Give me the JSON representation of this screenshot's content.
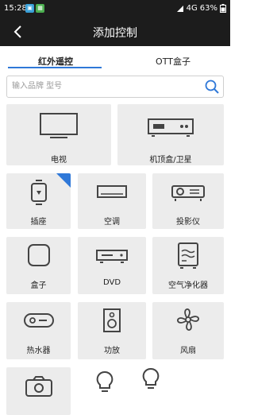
{
  "status_bar": {
    "time": "15:28",
    "network": "4G",
    "battery": "63%"
  },
  "header": {
    "title": "添加控制"
  },
  "tabs": [
    {
      "label": "红外遥控",
      "active": true
    },
    {
      "label": "OTT盒子",
      "active": false
    }
  ],
  "search": {
    "placeholder": "输入品牌 型号",
    "value": ""
  },
  "devices": [
    {
      "label": "电视"
    },
    {
      "label": "机顶盒/卫星"
    },
    {
      "label": "插座",
      "badge": true
    },
    {
      "label": "空调"
    },
    {
      "label": "投影仪"
    },
    {
      "label": "盒子"
    },
    {
      "label": "DVD"
    },
    {
      "label": "空气净化器"
    },
    {
      "label": "热水器"
    },
    {
      "label": "功放"
    },
    {
      "label": "风扇"
    }
  ],
  "colors": {
    "accent": "#2f78d8",
    "bar": "#1c1c1c",
    "tile": "#ececec"
  }
}
